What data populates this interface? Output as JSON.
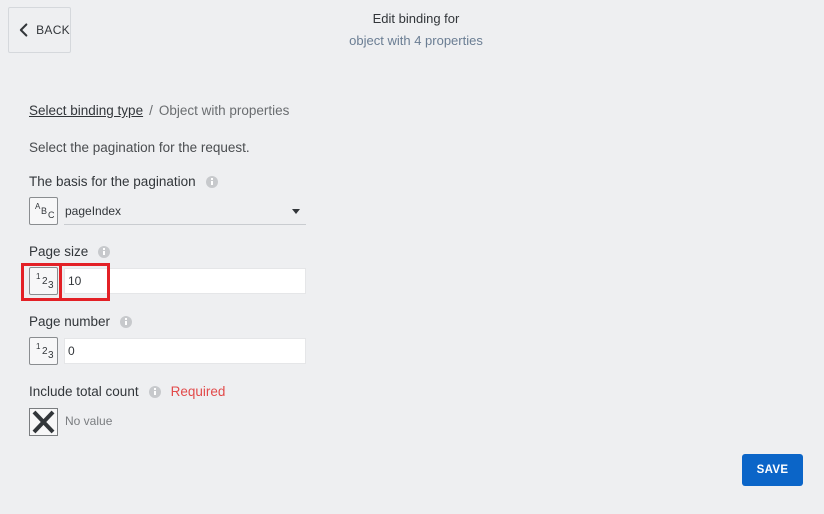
{
  "back_button": {
    "label": "BACK",
    "icon": "chevron-left-icon"
  },
  "header": {
    "title": "Edit binding for",
    "subtitle": "object with 4 properties"
  },
  "breadcrumb": {
    "link": "Select binding type",
    "separator": "/",
    "current": "Object with properties"
  },
  "description": "Select the pagination for the request.",
  "fields": {
    "basis": {
      "label": "The basis for the pagination",
      "type_badge": [
        "A",
        "B",
        "C"
      ],
      "value": "pageIndex"
    },
    "page_size": {
      "label": "Page size",
      "type_badge": [
        "1",
        "2",
        "3"
      ],
      "value": "10"
    },
    "page_number": {
      "label": "Page number",
      "type_badge": [
        "1",
        "2",
        "3"
      ],
      "value": "0"
    },
    "total_count": {
      "label": "Include total count",
      "required_label": "Required",
      "value_text": "No value"
    }
  },
  "save_button": {
    "label": "SAVE"
  },
  "colors": {
    "accent": "#0b65c8",
    "required": "#e24a4a",
    "highlight": "#e32026",
    "background": "#eeeff1"
  }
}
